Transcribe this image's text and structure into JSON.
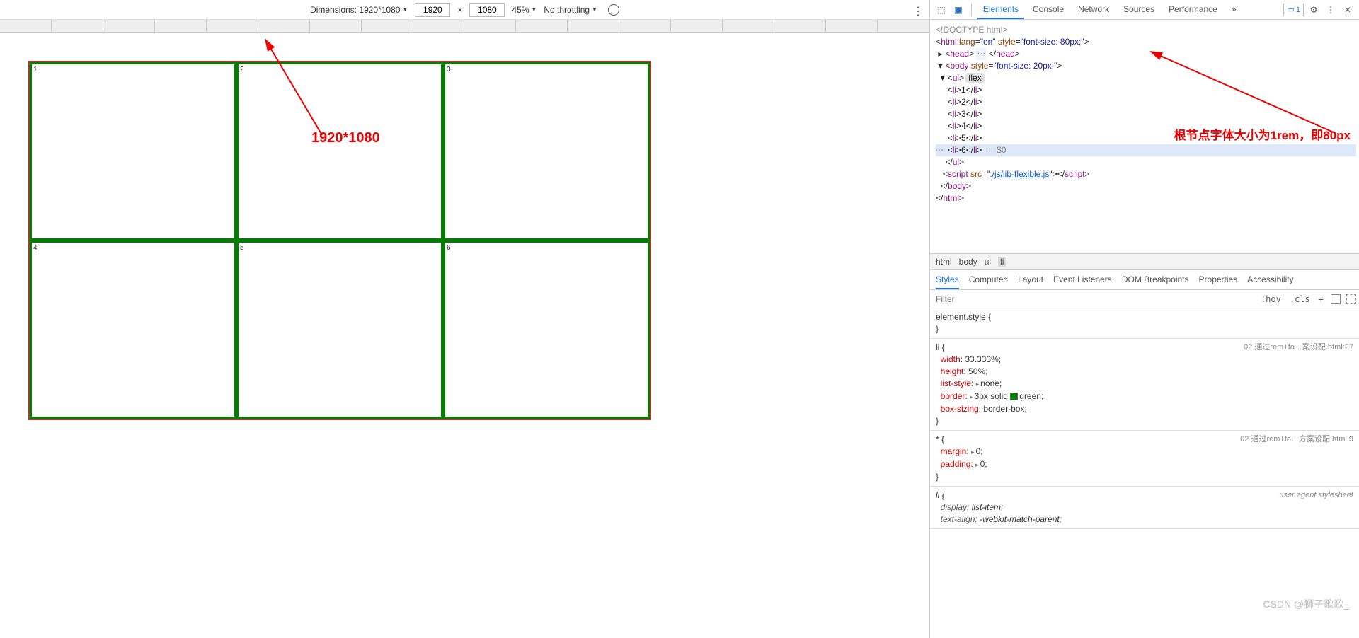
{
  "toolbar": {
    "dimensions_label": "Dimensions: 1920*1080",
    "width": "1920",
    "times": "×",
    "height": "1080",
    "zoom": "45%",
    "throttling": "No throttling"
  },
  "grid_cells": [
    "1",
    "2",
    "3",
    "4",
    "5",
    "6"
  ],
  "annotation_left": "1920*1080",
  "devtools": {
    "tabs": [
      "Elements",
      "Console",
      "Network",
      "Sources",
      "Performance"
    ],
    "more": "»",
    "issue_count": "1"
  },
  "dom": {
    "doctype": "<!DOCTYPE html>",
    "html_open": {
      "tag": "html",
      "attrs": "lang=\"en\" style=\"font-size: 80px;\""
    },
    "head": {
      "tag": "head"
    },
    "body_open": {
      "tag": "body",
      "attrs": "style=\"font-size: 20px;\""
    },
    "ul_open": {
      "tag": "ul",
      "pill": "flex"
    },
    "lis": [
      "1",
      "2",
      "3",
      "4",
      "5",
      "6"
    ],
    "selected_eq": "== $0",
    "ul_close": "</ul>",
    "script_line": {
      "tag": "script",
      "src": "./js/lib-flexible.js"
    },
    "body_close": "</body>",
    "html_close": "</html>"
  },
  "annotation_right": "根节点字体大小为1rem，即80px",
  "breadcrumb": [
    "html",
    "body",
    "ul",
    "li"
  ],
  "styles_tabs": [
    "Styles",
    "Computed",
    "Layout",
    "Event Listeners",
    "DOM Breakpoints",
    "Properties",
    "Accessibility"
  ],
  "filter_placeholder": "Filter",
  "filter_btns": {
    "hov": ":hov",
    "cls": ".cls",
    "plus": "+"
  },
  "rules": {
    "r0": {
      "sel": "element.style {",
      "close": "}"
    },
    "r1": {
      "sel": "li {",
      "src": "02.通过rem+fo…案设配.html:27",
      "props": [
        {
          "p": "width",
          "v": "33.333%"
        },
        {
          "p": "height",
          "v": "50%"
        },
        {
          "p": "list-style",
          "v": "none",
          "chev": true
        },
        {
          "p": "border",
          "v": "3px solid ",
          "swatch": true,
          "v2": "green",
          "chev": true
        },
        {
          "p": "box-sizing",
          "v": "border-box"
        }
      ],
      "close": "}"
    },
    "r2": {
      "sel": "* {",
      "src": "02.通过rem+fo…方案设配.html:9",
      "props": [
        {
          "p": "margin",
          "v": "0",
          "chev": true
        },
        {
          "p": "padding",
          "v": "0",
          "chev": true
        }
      ],
      "close": "}"
    },
    "r3": {
      "sel": "li {",
      "src": "user agent stylesheet",
      "props": [
        {
          "p": "display",
          "v": "list-item"
        },
        {
          "p": "text-align",
          "v": "-webkit-match-parent"
        }
      ]
    }
  },
  "watermark": "CSDN @狮子歌歌_"
}
